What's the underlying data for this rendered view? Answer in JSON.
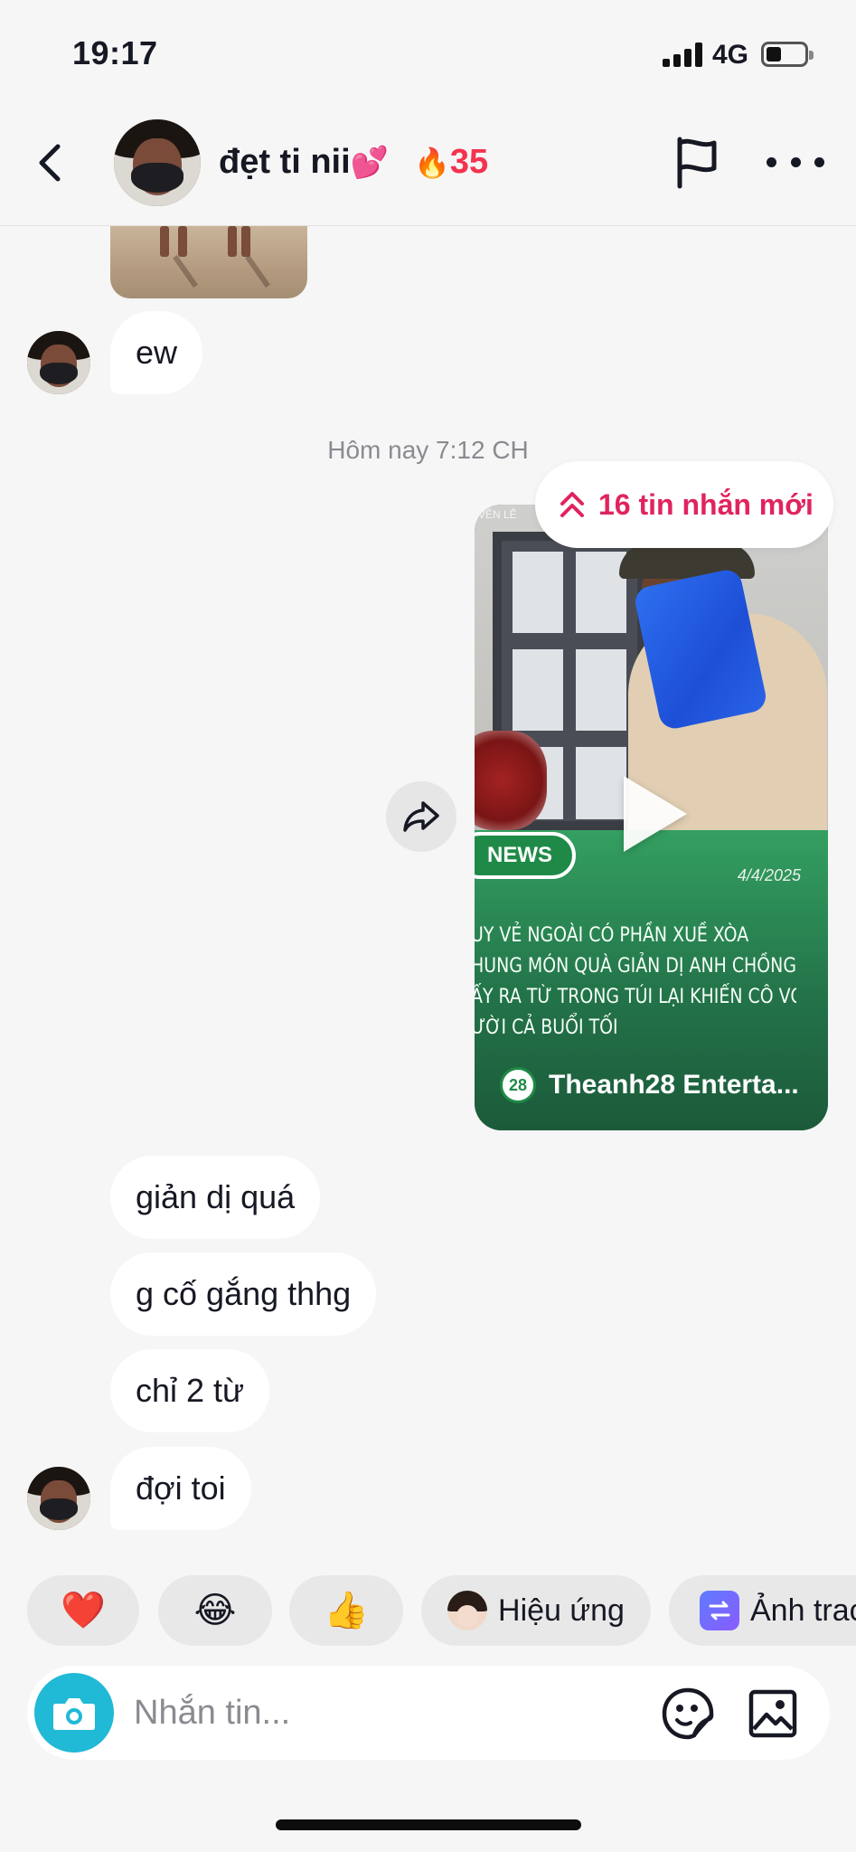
{
  "status_bar": {
    "time": "19:17",
    "network": "4G"
  },
  "header": {
    "name": "đẹt ti nii",
    "name_emoji": "💕",
    "streak_icon": "flame-icon",
    "streak_count": "35"
  },
  "conversation": {
    "messages_before": [
      {
        "text": "ew"
      }
    ],
    "timestamp": "Hôm nay 7:12 CH",
    "new_messages_pill": "16 tin nhắn mới",
    "video": {
      "top_label": "VẼN LÊ",
      "badge": "NEWS",
      "date": "4/4/2025",
      "caption_lines": [
        "UY VẺ NGOÀI CÓ PHẦN XUỀ XÒA",
        "HUNG MÓN QUÀ GIẢN DỊ ANH CHỒNG",
        "ẤY RA TỪ TRONG TÚI LẠI KHIẾN CÔ VỢ",
        "ƯỜI CẢ BUỔI TỐI"
      ],
      "channel_logo_text": "28",
      "channel": "Theanh28 Enterta..."
    },
    "messages_after": [
      {
        "text": "giản dị quá"
      },
      {
        "text": "g cố gắng thhg"
      },
      {
        "text": "chỉ 2 từ"
      },
      {
        "text": "đợi toi"
      }
    ]
  },
  "quick_replies": [
    {
      "emoji": "❤️",
      "icon": "heart-icon"
    },
    {
      "emoji": "😂",
      "icon": "laughing-emoji-icon"
    },
    {
      "emoji": "👍",
      "icon": "thumbs-up-icon"
    },
    {
      "label": "Hiệu ứng",
      "icon": "effect-avatar-icon"
    },
    {
      "label": "Ảnh trac",
      "icon": "album-icon"
    }
  ],
  "composer": {
    "placeholder": "Nhắn tin..."
  },
  "colors": {
    "accent_pink": "#e0245e",
    "streak_red": "#f5334f",
    "camera_teal": "#20b9d6",
    "bubble_bg": "#ffffff",
    "page_bg": "#f6f6f6"
  }
}
